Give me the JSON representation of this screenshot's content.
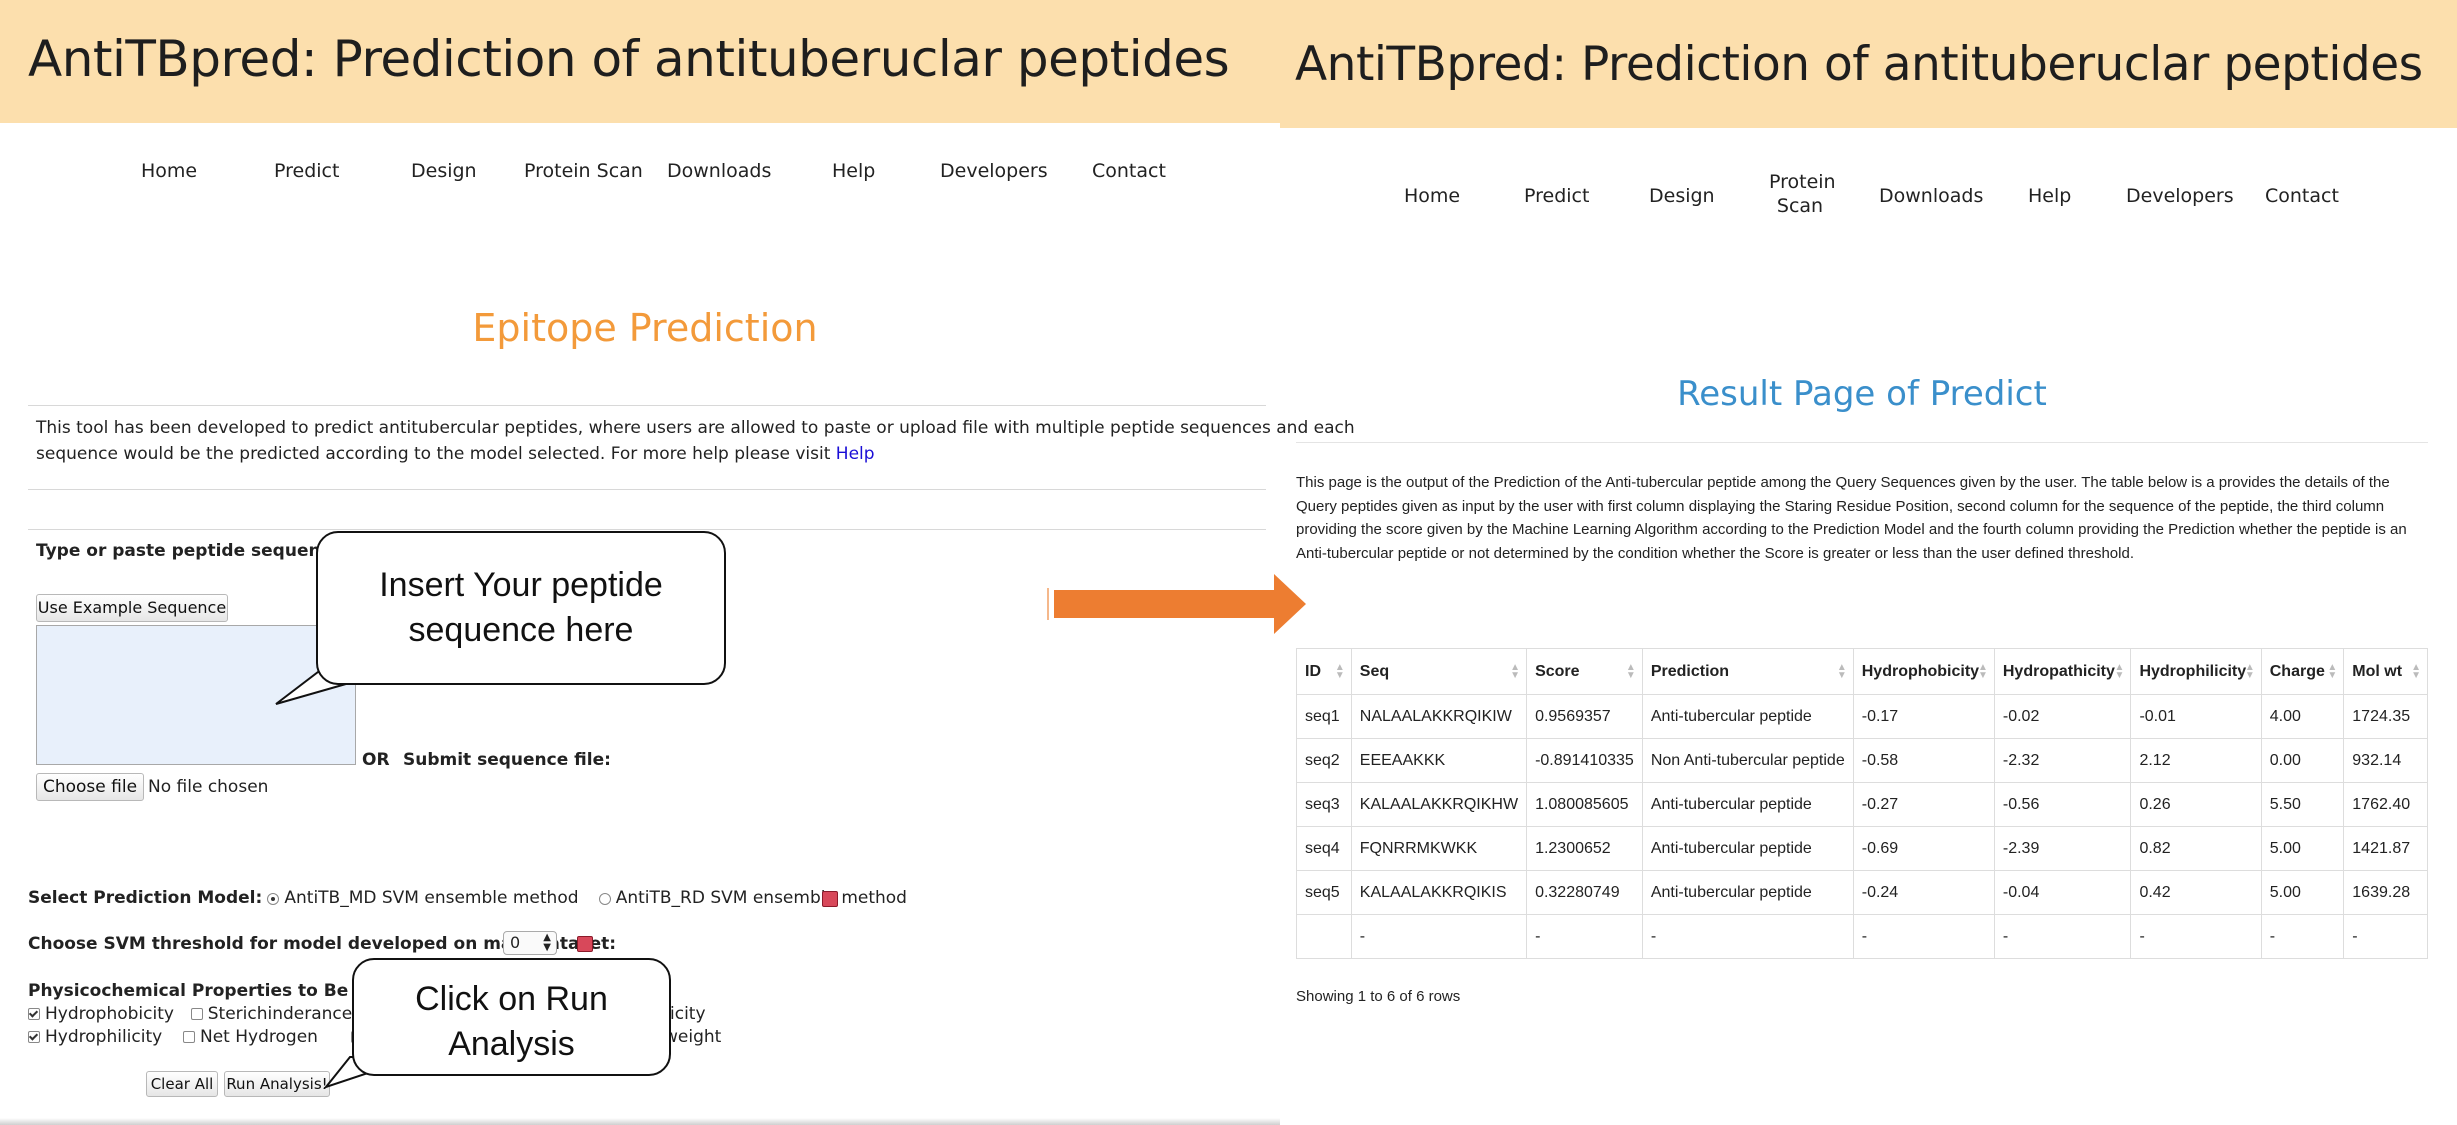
{
  "left": {
    "title": "AntiTBpred: Prediction of antituberuclar peptides",
    "nav": [
      "Home",
      "Predict",
      "Design",
      "Protein Scan",
      "Downloads",
      "Help",
      "Developers",
      "Contact"
    ],
    "page_heading": "Epitope Prediction",
    "intro_line1": "This tool has been developed to predict antitubercular peptides, where users are allowed to paste or upload file with multiple peptide sequences and each",
    "intro_line2": "sequence would be the predicted according to the model selected. For more help please visit",
    "help_link": "Help",
    "paste_label": "Type or paste peptide sequence(s) in",
    "example_button": "Use Example Sequence",
    "or_label": "OR",
    "submit_file_label": "Submit sequence file:",
    "choose_file_button": "Choose file",
    "no_file_text": "No file chosen",
    "model_label": "Select Prediction Model:",
    "model_option1": "AntiTB_MD SVM ensemble method",
    "model_option2": "AntiTB_RD SVM ensemble method",
    "threshold_label": "Choose SVM threshold for model developed on main dataset:",
    "threshold_value": "0",
    "physchem_label": "Physicochemical Properties to Be Displaye",
    "checkbox_row1": [
      "Hydrophobicity",
      "Sterichinderance",
      "S"
    ],
    "checkbox_row1_tail": "icity",
    "checkbox_row2": [
      "Hydrophilicity",
      "Net Hydrogen",
      "C"
    ],
    "checkbox_row2_tail": "weight",
    "clear_button": "Clear All",
    "run_button": "Run Analysis!",
    "callout_insert": "Insert Your peptide sequence here",
    "callout_run": "Click on Run Analysis"
  },
  "right": {
    "title": "AntiTBpred: Prediction of antituberuclar peptides",
    "nav": [
      "Home",
      "Predict",
      "Design",
      "Protein Scan",
      "Downloads",
      "Help",
      "Developers",
      "Contact"
    ],
    "page_heading": "Result Page of Predict",
    "description": "This page is the output of the Prediction of the Anti-tubercular peptide among the Query Sequences given by the user. The table below is a provides the details of the Query peptides given as input by the user with first column displaying the Staring Residue Position, second column for the sequence of the peptide, the third column providing the score given by the Machine Learning Algorithm according to the Prediction Model and the fourth column providing the Prediction whether the peptide is an Anti-tubercular peptide or not determined by the condition whether the Score is greater or less than the user defined threshold.",
    "table": {
      "columns": [
        "ID",
        "Seq",
        "Score",
        "Prediction",
        "Hydrophobicity",
        "Hydropathicity",
        "Hydrophilicity",
        "Charge",
        "Mol wt"
      ],
      "rows": [
        [
          "seq1",
          "NALAALAKKRQIKIW",
          "0.9569357",
          "Anti-tubercular peptide",
          "-0.17",
          "-0.02",
          "-0.01",
          "4.00",
          "1724.35"
        ],
        [
          "seq2",
          "EEEAAKKK",
          "-0.891410335",
          "Non Anti-tubercular peptide",
          "-0.58",
          "-2.32",
          "2.12",
          "0.00",
          "932.14"
        ],
        [
          "seq3",
          "KALAALAKKRQIKHW",
          "1.080085605",
          "Anti-tubercular peptide",
          "-0.27",
          "-0.56",
          "0.26",
          "5.50",
          "1762.40"
        ],
        [
          "seq4",
          "FQNRRMKWKK",
          "1.2300652",
          "Anti-tubercular peptide",
          "-0.69",
          "-2.39",
          "0.82",
          "5.00",
          "1421.87"
        ],
        [
          "seq5",
          "KALAALAKKRQIKIS",
          "0.32280749",
          "Anti-tubercular peptide",
          "-0.24",
          "-0.04",
          "0.42",
          "5.00",
          "1639.28"
        ],
        [
          "",
          "-",
          "-",
          "-",
          "-",
          "-",
          "-",
          "-",
          "-"
        ]
      ]
    },
    "footer": "Showing 1 to 6 of 6 rows"
  },
  "colors": {
    "header_bg": "#fcdfad",
    "orange_heading": "#f39a3a",
    "blue_heading": "#3a8fcb",
    "arrow": "#ed7d31",
    "link": "#1a0dd6"
  },
  "icons": [
    "help-icon",
    "arrow-right-icon",
    "checkbox-icon",
    "radio-icon",
    "sort-icon"
  ]
}
